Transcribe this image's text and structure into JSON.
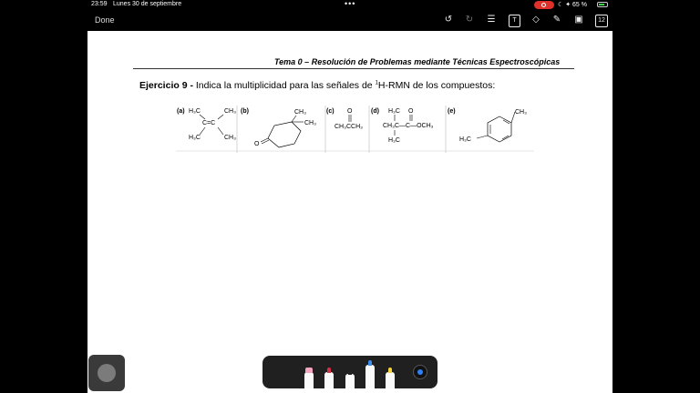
{
  "status_bar": {
    "time": "23:59",
    "date": "Lunes 30 de septiembre",
    "dots": "•••",
    "battery_text": "65 %"
  },
  "toolbar": {
    "done_label": "Done",
    "text_tool_label": "T",
    "page_count": "12"
  },
  "document": {
    "header": "Tema 0 – Resolución de Problemas mediante Técnicas Espectroscópicas",
    "exercise_number": "Ejercicio 9 -",
    "exercise_text_1": " Indica la multiplicidad para las señales de ",
    "superscript": "1",
    "exercise_text_2": "H-RMN de los compuestos:",
    "compounds": [
      {
        "label": "(a)",
        "lines": [
          "H₃C",
          "CH₃",
          "C=C",
          "H₃C",
          "CH₃"
        ]
      },
      {
        "label": "(b)",
        "lines": [
          "CH₃",
          "CH₃",
          "O"
        ]
      },
      {
        "label": "(c)",
        "lines": [
          "O",
          "CH₃CCH₃"
        ]
      },
      {
        "label": "(d)",
        "lines": [
          "H₃C",
          "O",
          "CH₃C—C—OCH₃",
          "H₃C"
        ]
      },
      {
        "label": "(e)",
        "lines": [
          "CH₃",
          "H₃C"
        ]
      }
    ]
  },
  "colors": {
    "record": "#e0302a",
    "ink_active": "#2f7ff5",
    "pen_pink": "#f3a6c0",
    "pen_red": "#d6304a",
    "pen_black": "#222222",
    "pen_blue": "#3d8df0",
    "pen_yellow": "#f4d23a"
  },
  "icons": [
    "undo-icon",
    "redo-icon",
    "notes-icon",
    "text-icon",
    "shapes-icon",
    "pen-icon",
    "images-icon",
    "pages-icon"
  ]
}
